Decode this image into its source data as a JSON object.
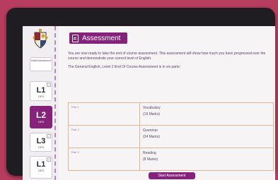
{
  "header": {
    "title": "Assessment",
    "icon": "document-icon"
  },
  "sidebar": {
    "items": [
      {
        "label": "Initial Assessment",
        "type": "text"
      },
      {
        "label": "L1",
        "sublabel": "GES",
        "corner": "✓"
      },
      {
        "label": "L2",
        "sublabel": "GES",
        "active": true
      },
      {
        "label": "L3",
        "sublabel": "GES",
        "corner": "✓"
      },
      {
        "label": "L1",
        "sublabel": "GES",
        "corner": "✓"
      }
    ]
  },
  "intro": {
    "p1": "You are now ready to take the end of course assessment. This assessment will show how much you have progressed over the course and demonstrate your current level of English.",
    "p2": "The General English, Level 2 End Of Course Assessment is in six parts:"
  },
  "parts": [
    {
      "part": "Part 1",
      "name": "Vocabulary",
      "marks": "(19 Marks)"
    },
    {
      "part": "Part 2",
      "name": "Grammar",
      "marks": "(24 Marks)"
    },
    {
      "part": "Part 3",
      "name": "Reading",
      "marks": "(8 Marks)"
    }
  ],
  "start_button": {
    "label": "Start Assessment"
  },
  "colors": {
    "accent": "#85237a",
    "background": "#b73d5e",
    "table_border": "#e3b594"
  }
}
